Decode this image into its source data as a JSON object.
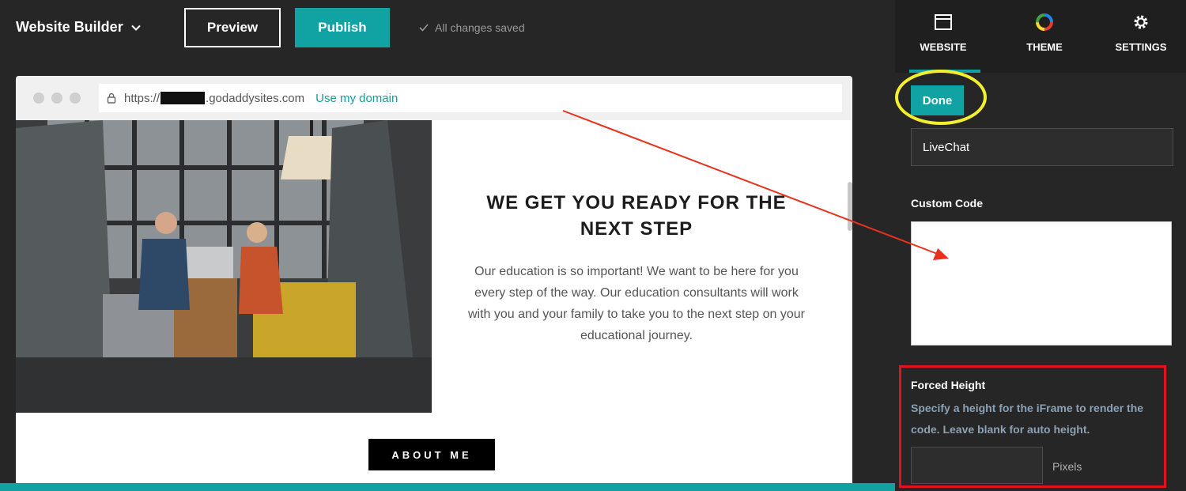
{
  "topbar": {
    "brand": "Website Builder",
    "preview_label": "Preview",
    "publish_label": "Publish",
    "saved_status": "All changes saved"
  },
  "browser": {
    "url_prefix": "https://",
    "url_suffix": ".godaddysites.com",
    "use_domain": "Use my domain"
  },
  "site": {
    "headline": "WE GET YOU READY FOR THE NEXT STEP",
    "body": "Our education is so important! We want to be here for you every step of the way. Our education consultants will work with you and your family to take you to the next step on your educational journey.",
    "button": "ABOUT ME"
  },
  "panel": {
    "tabs": [
      {
        "label": "WEBSITE",
        "icon": "window-icon"
      },
      {
        "label": "THEME",
        "icon": "color-wheel-icon"
      },
      {
        "label": "SETTINGS",
        "icon": "gear-icon"
      }
    ],
    "done_label": "Done",
    "section_value": "LiveChat",
    "custom_code_label": "Custom Code",
    "forced_height_title": "Forced Height",
    "forced_height_help": "Specify a height for the iFrame to render the code. Leave blank for auto height.",
    "pixels_label": "Pixels"
  },
  "colors": {
    "accent": "#11a3a3",
    "highlight_circle": "#f4ef2d",
    "highlight_box": "#e0141e",
    "arrow": "#e8321e"
  }
}
